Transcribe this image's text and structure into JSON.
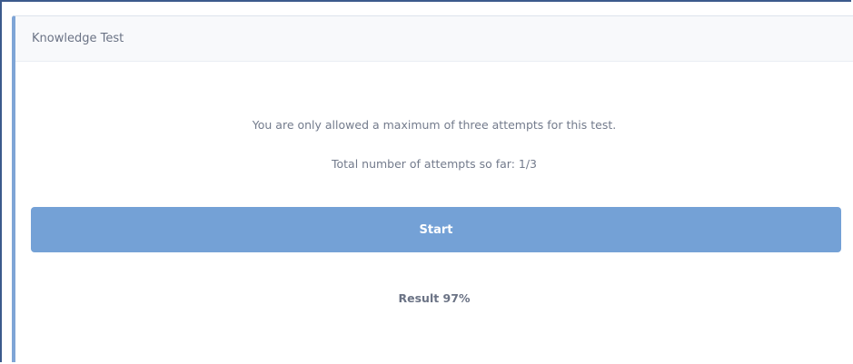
{
  "card": {
    "title": "Knowledge Test",
    "max_attempts_notice": "You are only allowed a maximum of three attempts for this test.",
    "attempts_so_far": "Total number of attempts so far: 1/3",
    "start_label": "Start",
    "result_text": "Result 97%"
  },
  "colors": {
    "accent": "#74a1d6",
    "card_border_accent": "#7fa5d6",
    "window_border": "#3c5a8c"
  }
}
